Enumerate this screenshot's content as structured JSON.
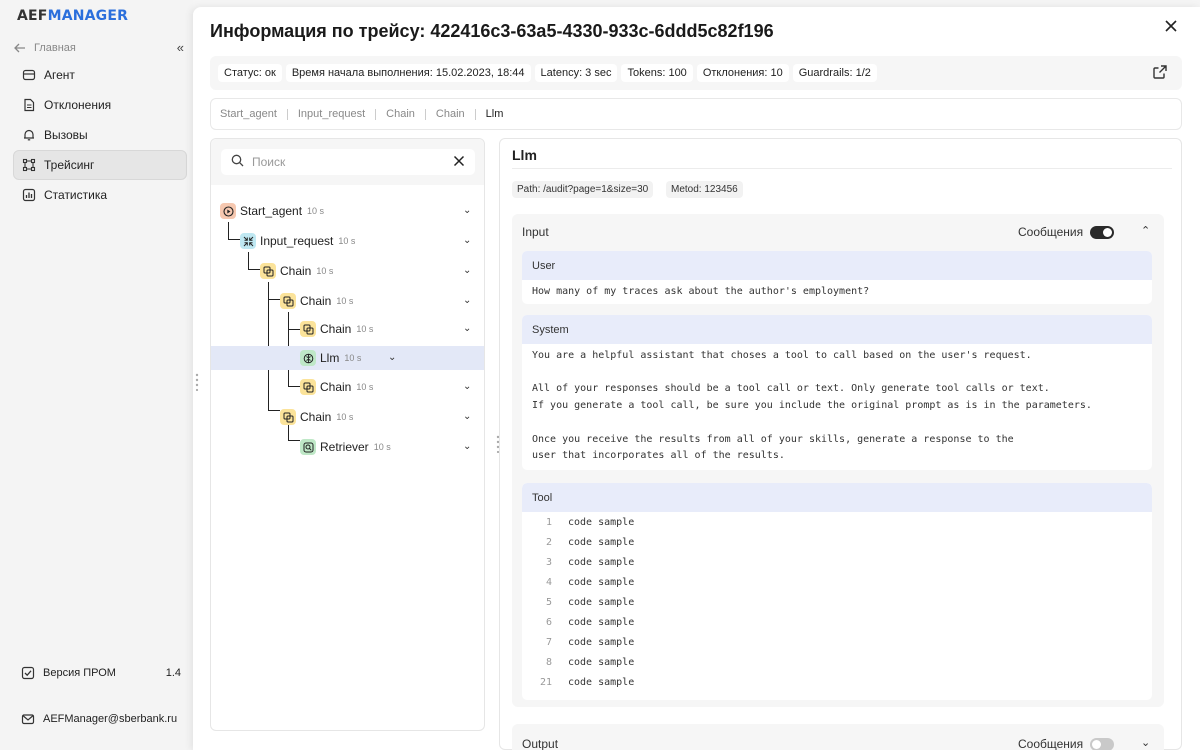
{
  "sidebar": {
    "logo_a": "AEF",
    "logo_b": "MANAGER",
    "back_label": "Главная",
    "items": [
      {
        "label": "Агент",
        "icon": "box-icon"
      },
      {
        "label": "Отклонения",
        "icon": "file-icon"
      },
      {
        "label": "Вызовы",
        "icon": "bell-icon"
      },
      {
        "label": "Трейсинг",
        "icon": "tracing-icon",
        "active": true
      },
      {
        "label": "Статистика",
        "icon": "chart-icon"
      }
    ],
    "version_label": "Версия ПРОМ",
    "version_value": "1.4",
    "email": "AEFManager@sberbank.ru"
  },
  "modal": {
    "title": "Информация по трейсу: 422416c3-63a5-4330-933c-6ddd5c82f196",
    "status_chips": [
      "Статус: ок",
      "Время начала выполнения: 15.02.2023, 18:44",
      "Latency: 3 sec",
      "Tokens: 100",
      "Отклонения: 10",
      "Guardrails: 1/2"
    ],
    "breadcrumbs": [
      "Start_agent",
      "Input_request",
      "Chain",
      "Chain",
      "Llm"
    ]
  },
  "tree": {
    "search_placeholder": "Поиск",
    "nodes": [
      {
        "label": "Start_agent",
        "duration": "10 s",
        "icon": "play-icon"
      },
      {
        "label": "Input_request",
        "duration": "10 s",
        "icon": "collapse-arrows-icon"
      },
      {
        "label": "Chain",
        "duration": "10 s",
        "icon": "chain-icon"
      },
      {
        "label": "Chain",
        "duration": "10 s",
        "icon": "chain-icon"
      },
      {
        "label": "Chain",
        "duration": "10 s",
        "icon": "chain-icon"
      },
      {
        "label": "Llm",
        "duration": "10 s",
        "icon": "llm-icon"
      },
      {
        "label": "Chain",
        "duration": "10 s",
        "icon": "chain-icon"
      },
      {
        "label": "Chain",
        "duration": "10 s",
        "icon": "chain-icon"
      },
      {
        "label": "Retriever",
        "duration": "10 s",
        "icon": "retriever-icon"
      }
    ]
  },
  "detail": {
    "title": "Llm",
    "path_tag": "Path: /audit?page=1&size=30",
    "method_tag": "Metod: 123456",
    "input": {
      "label": "Input",
      "toggle_label": "Сообщения",
      "toggle_on": true,
      "user_label": "User",
      "user_text": "How many of my traces ask about the author's employment?",
      "system_label": "System",
      "system_text": "You are a helpful assistant that choses a tool to call based on the user's request.\n\nAll of your responses should be a tool call or text. Only generate tool calls or text.\nIf you generate a tool call, be sure you include the original prompt as is in the parameters.\n\nOnce you receive the results from all of your skills, generate a response to the\nuser that incorporates all of the results.",
      "tool_label": "Tool",
      "code_lines": [
        {
          "n": "1",
          "text": "code sample"
        },
        {
          "n": "2",
          "text": "code sample"
        },
        {
          "n": "3",
          "text": "code sample"
        },
        {
          "n": "4",
          "text": "code sample"
        },
        {
          "n": "5",
          "text": "code sample"
        },
        {
          "n": "6",
          "text": "code sample"
        },
        {
          "n": "7",
          "text": "code sample"
        },
        {
          "n": "8",
          "text": "code sample"
        },
        {
          "n": "21",
          "text": "code sample"
        }
      ]
    },
    "output": {
      "label": "Output",
      "toggle_label": "Сообщения",
      "toggle_on": false
    }
  },
  "colors": {
    "accent": "#2b6fdc",
    "toggle_on": "#2a2a2a",
    "toggle_off": "#c9c9c9",
    "selected_row": "#e3e8f7",
    "play_icon_bg": "#f6c8b0",
    "input_icon_bg": "#bfe8f2",
    "chain_icon_bg": "#fbe39a",
    "llm_icon_bg": "#bfe8c7"
  }
}
